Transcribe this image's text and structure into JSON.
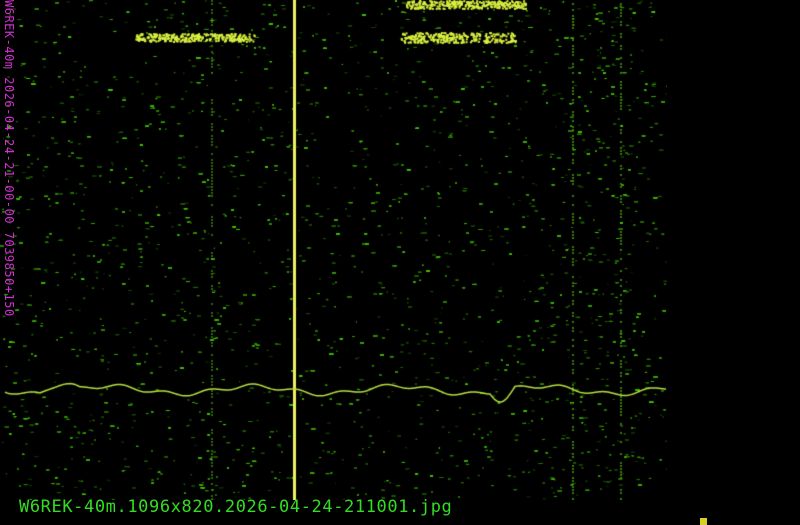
{
  "spectrogram": {
    "side_label": "W6REK-40m 2026-04-24-21-00-00 7039850+150",
    "filename": "W6REK-40m.1096x820.2026-04-24-211001.jpg",
    "colors": {
      "noise": "#3a9a10",
      "bright": "#e8f060",
      "label": "#d030d0",
      "filename": "#33dd22",
      "carrier": "#f0f060"
    }
  }
}
